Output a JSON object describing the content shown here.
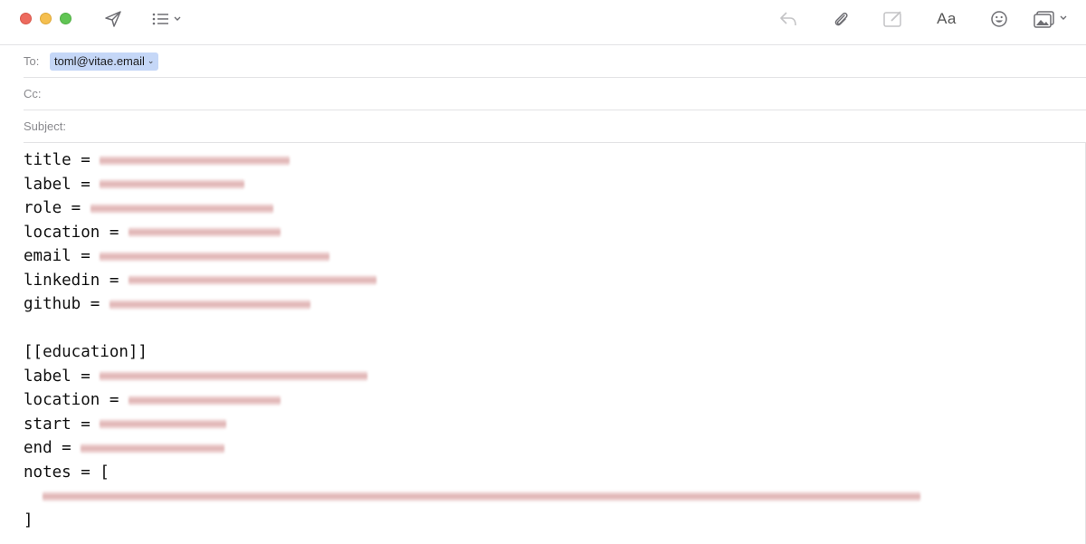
{
  "toolbar": {
    "icons": [
      "send-icon",
      "list-format-icon",
      "reply-icon",
      "paperclip-icon",
      "markup-icon",
      "font-icon",
      "emoji-icon",
      "photo-browser-icon"
    ],
    "font_label": "Aa"
  },
  "header": {
    "to_label": "To:",
    "to_recipient": "toml@vitae.email",
    "cc_label": "Cc:",
    "subject_label": "Subject:",
    "subject_value": ""
  },
  "body": {
    "lines": [
      {
        "key": "title = ",
        "redacted": true
      },
      {
        "key": "label = ",
        "redacted": true
      },
      {
        "key": "role = ",
        "redacted": true
      },
      {
        "key": "location = ",
        "redacted": true
      },
      {
        "key": "email = ",
        "redacted": true
      },
      {
        "key": "linkedin = ",
        "redacted": true
      },
      {
        "key": "github = ",
        "redacted": true
      },
      {
        "key": "",
        "redacted": false
      },
      {
        "key": "[[education]]",
        "redacted": false
      },
      {
        "key": "label = ",
        "redacted": true
      },
      {
        "key": "location = ",
        "redacted": true
      },
      {
        "key": "start = ",
        "redacted": true
      },
      {
        "key": "end = ",
        "redacted": true
      },
      {
        "key": "notes = [",
        "redacted": false
      },
      {
        "key": "  ",
        "redacted": true
      },
      {
        "key": "]",
        "redacted": false
      }
    ]
  },
  "colors": {
    "token_bg": "#c5d7f7",
    "redaction": "#c36e6e",
    "close": "#ed6a5e",
    "minimize": "#f5bf4f",
    "zoom": "#61c554"
  }
}
